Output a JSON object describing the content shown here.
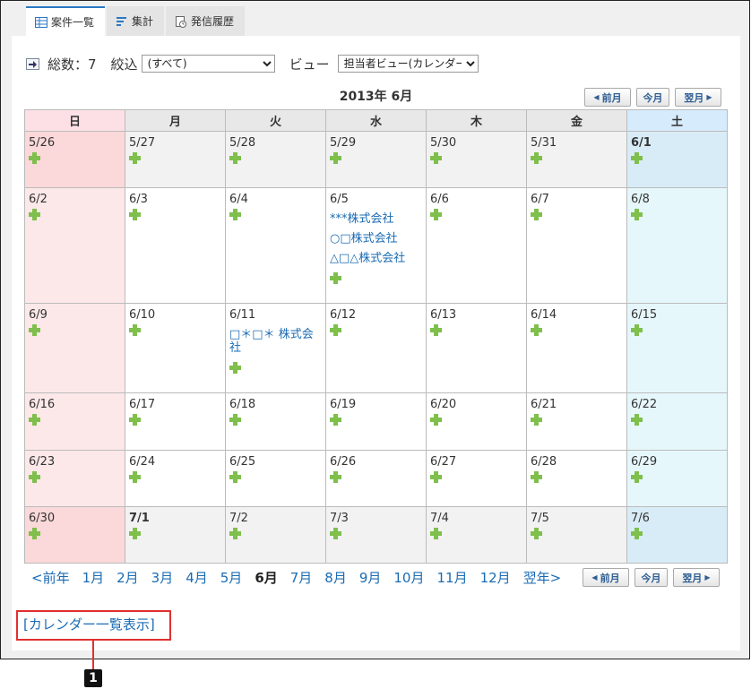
{
  "tabs": [
    {
      "label": "案件一覧",
      "icon": "table-icon"
    },
    {
      "label": "集計",
      "icon": "list-icon"
    },
    {
      "label": "発信履歴",
      "icon": "history-icon"
    }
  ],
  "toolbar": {
    "total_label": "総数：7",
    "filter_label": "絞込",
    "filter_value": "(すべて)",
    "view_label": "ビュー",
    "view_value": "担当者ビュー(カレンダー)"
  },
  "month_title": "2013年 6月",
  "nav": {
    "prev": "前月",
    "today": "今月",
    "next": "翌月"
  },
  "weekdays": [
    "日",
    "月",
    "火",
    "水",
    "木",
    "金",
    "土"
  ],
  "weeks": [
    [
      {
        "date": "5/26",
        "events": []
      },
      {
        "date": "5/27",
        "events": []
      },
      {
        "date": "5/28",
        "events": []
      },
      {
        "date": "5/29",
        "events": []
      },
      {
        "date": "5/30",
        "events": []
      },
      {
        "date": "5/31",
        "events": []
      },
      {
        "date": "6/1",
        "events": []
      }
    ],
    [
      {
        "date": "6/2",
        "events": []
      },
      {
        "date": "6/3",
        "events": []
      },
      {
        "date": "6/4",
        "events": []
      },
      {
        "date": "6/5",
        "events": [
          "***株式会社",
          "○□株式会社",
          "△□△株式会社"
        ]
      },
      {
        "date": "6/6",
        "events": []
      },
      {
        "date": "6/7",
        "events": []
      },
      {
        "date": "6/8",
        "events": []
      }
    ],
    [
      {
        "date": "6/9",
        "events": []
      },
      {
        "date": "6/10",
        "events": []
      },
      {
        "date": "6/11",
        "events": [
          "□＊□＊ 株式会社"
        ]
      },
      {
        "date": "6/12",
        "events": []
      },
      {
        "date": "6/13",
        "events": []
      },
      {
        "date": "6/14",
        "events": []
      },
      {
        "date": "6/15",
        "events": []
      }
    ],
    [
      {
        "date": "6/16",
        "events": []
      },
      {
        "date": "6/17",
        "events": []
      },
      {
        "date": "6/18",
        "events": []
      },
      {
        "date": "6/19",
        "events": []
      },
      {
        "date": "6/20",
        "events": []
      },
      {
        "date": "6/21",
        "events": []
      },
      {
        "date": "6/22",
        "events": []
      }
    ],
    [
      {
        "date": "6/23",
        "events": []
      },
      {
        "date": "6/24",
        "events": []
      },
      {
        "date": "6/25",
        "events": []
      },
      {
        "date": "6/26",
        "events": []
      },
      {
        "date": "6/27",
        "events": []
      },
      {
        "date": "6/28",
        "events": []
      },
      {
        "date": "6/29",
        "events": []
      }
    ],
    [
      {
        "date": "6/30",
        "events": []
      },
      {
        "date": "7/1",
        "events": []
      },
      {
        "date": "7/2",
        "events": []
      },
      {
        "date": "7/3",
        "events": []
      },
      {
        "date": "7/4",
        "events": []
      },
      {
        "date": "7/5",
        "events": []
      },
      {
        "date": "7/6",
        "events": []
      }
    ]
  ],
  "month_links": [
    "<前年",
    "1月",
    "2月",
    "3月",
    "4月",
    "5月",
    "6月",
    "7月",
    "8月",
    "9月",
    "10月",
    "11月",
    "12月",
    "翌年>"
  ],
  "current_month_link": "6月",
  "calendar_list_link": "[カレンダー一覧表示]",
  "annotation_number": "1",
  "colors": {
    "accent": "#2a78c4",
    "link": "#1a6bb3",
    "annotation": "#e03030",
    "add_icon": "#7fbf4c"
  }
}
